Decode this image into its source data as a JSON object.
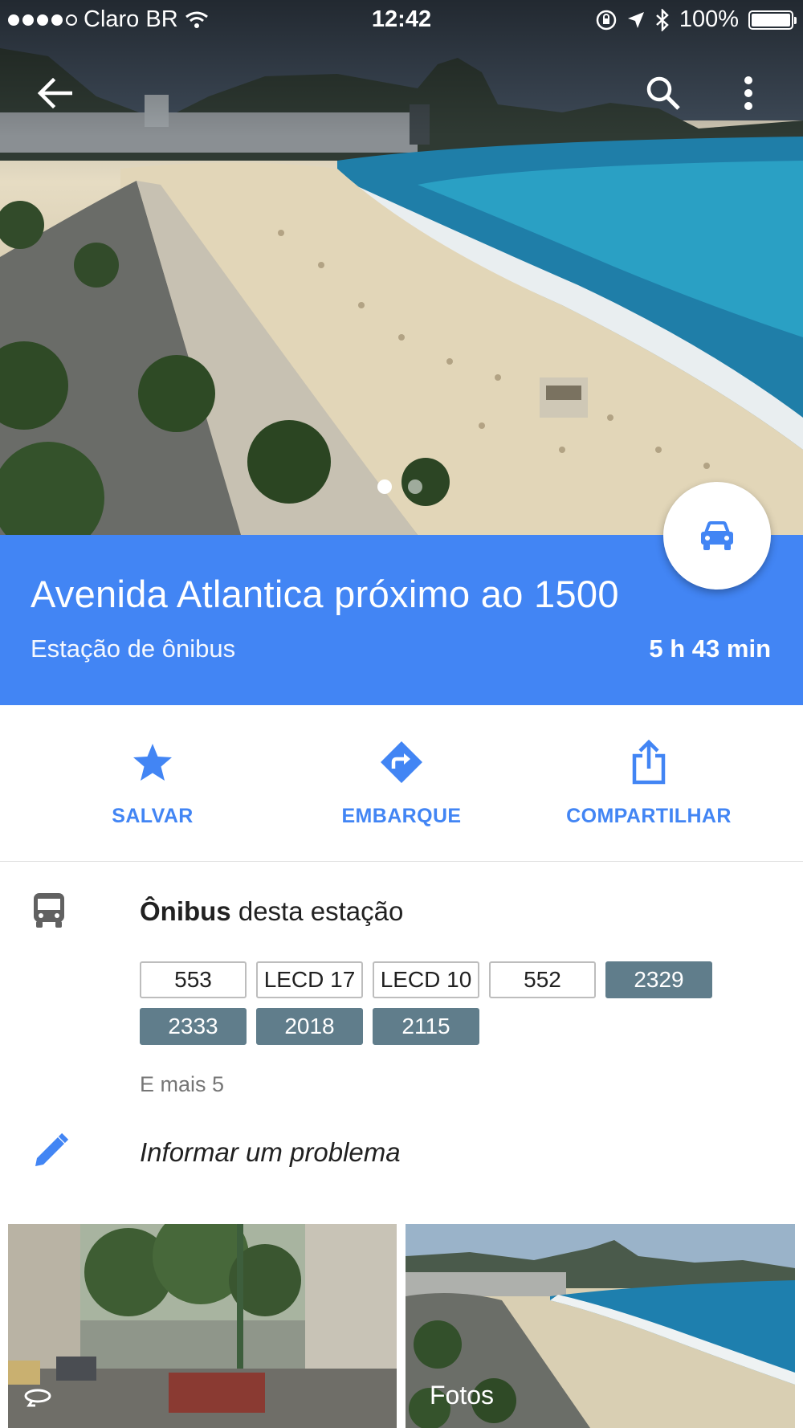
{
  "status_bar": {
    "carrier": "Claro BR",
    "time": "12:42",
    "battery": "100%",
    "battery_level": 1.0
  },
  "hero": {
    "image_description_icon": "beach-photo",
    "page_count": 2,
    "active_page": 0
  },
  "place": {
    "title": "Avenida Atlantica próximo ao 1500",
    "category": "Estação de ônibus",
    "eta": "5 h 43 min"
  },
  "actions": {
    "save": "SALVAR",
    "board": "EMBARQUE",
    "share": "COMPARTILHAR"
  },
  "bus_section": {
    "heading_bold": "Ônibus",
    "heading_rest": " desta estação",
    "routes": [
      {
        "label": "553",
        "style": "outline"
      },
      {
        "label": "LECD 17",
        "style": "outline"
      },
      {
        "label": "LECD 10",
        "style": "outline"
      },
      {
        "label": "552",
        "style": "outline"
      },
      {
        "label": "2329",
        "style": "filled"
      },
      {
        "label": "2333",
        "style": "filled"
      },
      {
        "label": "2018",
        "style": "filled"
      },
      {
        "label": "2115",
        "style": "filled"
      }
    ],
    "more": "E mais 5"
  },
  "report": {
    "label": "Informar um problema"
  },
  "photos": {
    "fotos_label": "Fotos"
  },
  "colors": {
    "brand_blue": "#4285f4",
    "chip_filled": "#607d8b"
  }
}
